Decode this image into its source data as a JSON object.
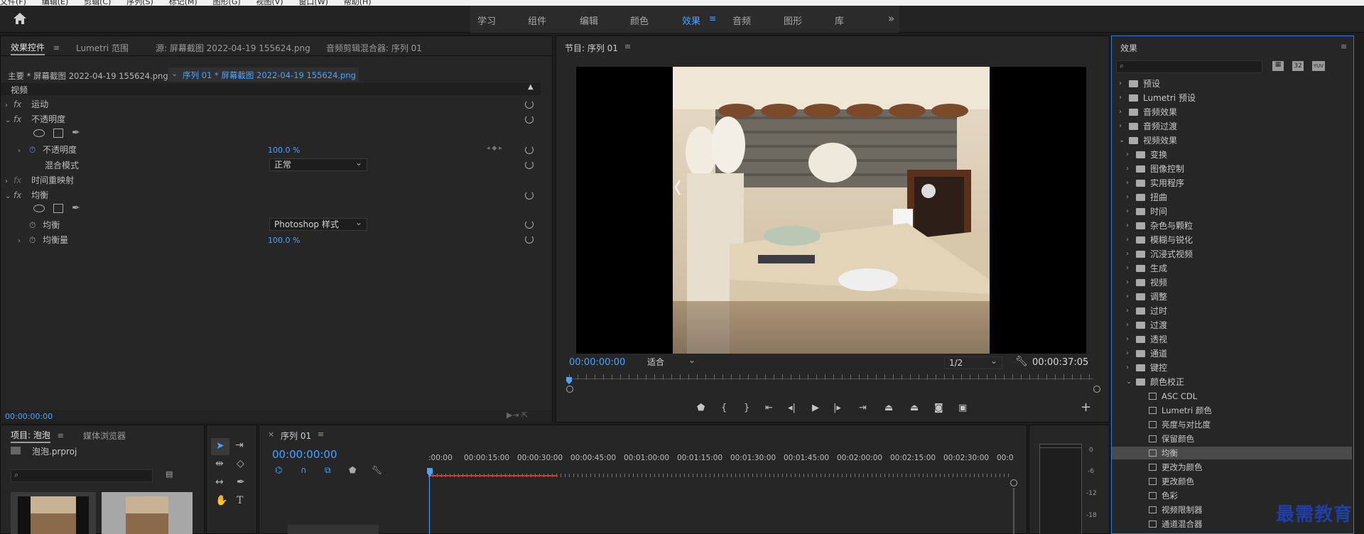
{
  "menu": [
    "文件(F)",
    "编辑(E)",
    "剪辑(C)",
    "序列(S)",
    "标记(M)",
    "图形(G)",
    "视图(V)",
    "窗口(W)",
    "帮助(H)"
  ],
  "workspaces": {
    "tabs": [
      "学习",
      "组件",
      "编辑",
      "颜色",
      "效果",
      "音频",
      "图形",
      "库"
    ],
    "active": "效果",
    "more": "»"
  },
  "effect_controls": {
    "tabs": [
      "效果控件",
      "Lumetri 范围",
      "源: 屏幕截图 2022-04-19 155624.png",
      "音频剪辑混合器: 序列 01"
    ],
    "master_clip": "主要 * 屏幕截图 2022-04-19 155624.png",
    "sequence_clip": "序列 01 * 屏幕截图 2022-04-19 155624.png",
    "section": "视频",
    "motion": "运动",
    "opacity": "不透明度",
    "opacity_param": "不透明度",
    "opacity_value": "100.0 %",
    "blend_mode_label": "混合模式",
    "blend_mode_value": "正常",
    "time_remap": "时间重映射",
    "equalize": "均衡",
    "equalize_param": "均衡",
    "equalize_value": "Photoshop 样式",
    "equalize_amount_label": "均衡量",
    "equalize_amount_value": "100.0 %",
    "timecode": "00:00:00:00"
  },
  "program": {
    "title": "节目: 序列 01",
    "timecode": "00:00:00:00",
    "fit": "适合",
    "resolution": "1/2",
    "duration": "00:00:37:05"
  },
  "effects_panel": {
    "title": "效果",
    "search_placeholder": "",
    "filter_labels": [
      "32",
      "YUV"
    ],
    "tree": [
      {
        "label": "预设",
        "level": 0,
        "open": false,
        "type": "folder"
      },
      {
        "label": "Lumetri 预设",
        "level": 0,
        "open": false,
        "type": "folder"
      },
      {
        "label": "音频效果",
        "level": 0,
        "open": false,
        "type": "folder"
      },
      {
        "label": "音频过渡",
        "level": 0,
        "open": false,
        "type": "folder"
      },
      {
        "label": "视频效果",
        "level": 0,
        "open": true,
        "type": "folder"
      },
      {
        "label": "变换",
        "level": 1,
        "open": false,
        "type": "folder"
      },
      {
        "label": "图像控制",
        "level": 1,
        "open": false,
        "type": "folder"
      },
      {
        "label": "实用程序",
        "level": 1,
        "open": false,
        "type": "folder"
      },
      {
        "label": "扭曲",
        "level": 1,
        "open": false,
        "type": "folder"
      },
      {
        "label": "时间",
        "level": 1,
        "open": false,
        "type": "folder"
      },
      {
        "label": "杂色与颗粒",
        "level": 1,
        "open": false,
        "type": "folder"
      },
      {
        "label": "模糊与锐化",
        "level": 1,
        "open": false,
        "type": "folder"
      },
      {
        "label": "沉浸式视频",
        "level": 1,
        "open": false,
        "type": "folder"
      },
      {
        "label": "生成",
        "level": 1,
        "open": false,
        "type": "folder"
      },
      {
        "label": "视频",
        "level": 1,
        "open": false,
        "type": "folder"
      },
      {
        "label": "调整",
        "level": 1,
        "open": false,
        "type": "folder"
      },
      {
        "label": "过时",
        "level": 1,
        "open": false,
        "type": "folder"
      },
      {
        "label": "过渡",
        "level": 1,
        "open": false,
        "type": "folder"
      },
      {
        "label": "透视",
        "level": 1,
        "open": false,
        "type": "folder"
      },
      {
        "label": "通道",
        "level": 1,
        "open": false,
        "type": "folder"
      },
      {
        "label": "键控",
        "level": 1,
        "open": false,
        "type": "folder"
      },
      {
        "label": "颜色校正",
        "level": 1,
        "open": true,
        "type": "folder"
      },
      {
        "label": "ASC CDL",
        "level": 2,
        "type": "effect"
      },
      {
        "label": "Lumetri 颜色",
        "level": 2,
        "type": "effect"
      },
      {
        "label": "亮度与对比度",
        "level": 2,
        "type": "effect"
      },
      {
        "label": "保留颜色",
        "level": 2,
        "type": "effect"
      },
      {
        "label": "均衡",
        "level": 2,
        "type": "effect",
        "selected": true
      },
      {
        "label": "更改为颜色",
        "level": 2,
        "type": "effect"
      },
      {
        "label": "更改颜色",
        "level": 2,
        "type": "effect"
      },
      {
        "label": "色彩",
        "level": 2,
        "type": "effect"
      },
      {
        "label": "视频限制器",
        "level": 2,
        "type": "effect"
      },
      {
        "label": "通道混合器",
        "level": 2,
        "type": "effect"
      }
    ]
  },
  "project": {
    "tabs": [
      "项目: 泡泡",
      "媒体浏览器"
    ],
    "file": "泡泡.prproj"
  },
  "timeline": {
    "title": "序列 01",
    "timecode": "00:00:00:00",
    "ruler": [
      ":00:00",
      "00:00:15:00",
      "00:00:30:00",
      "00:00:45:00",
      "00:01:00:00",
      "00:01:15:00",
      "00:01:30:00",
      "00:01:45:00",
      "00:02:00:00",
      "00:02:15:00",
      "00:02:30:00",
      "00:0"
    ]
  },
  "audio_meter": {
    "scale": [
      "0",
      "-6",
      "-12",
      "-18"
    ]
  },
  "watermark": "最需教育"
}
